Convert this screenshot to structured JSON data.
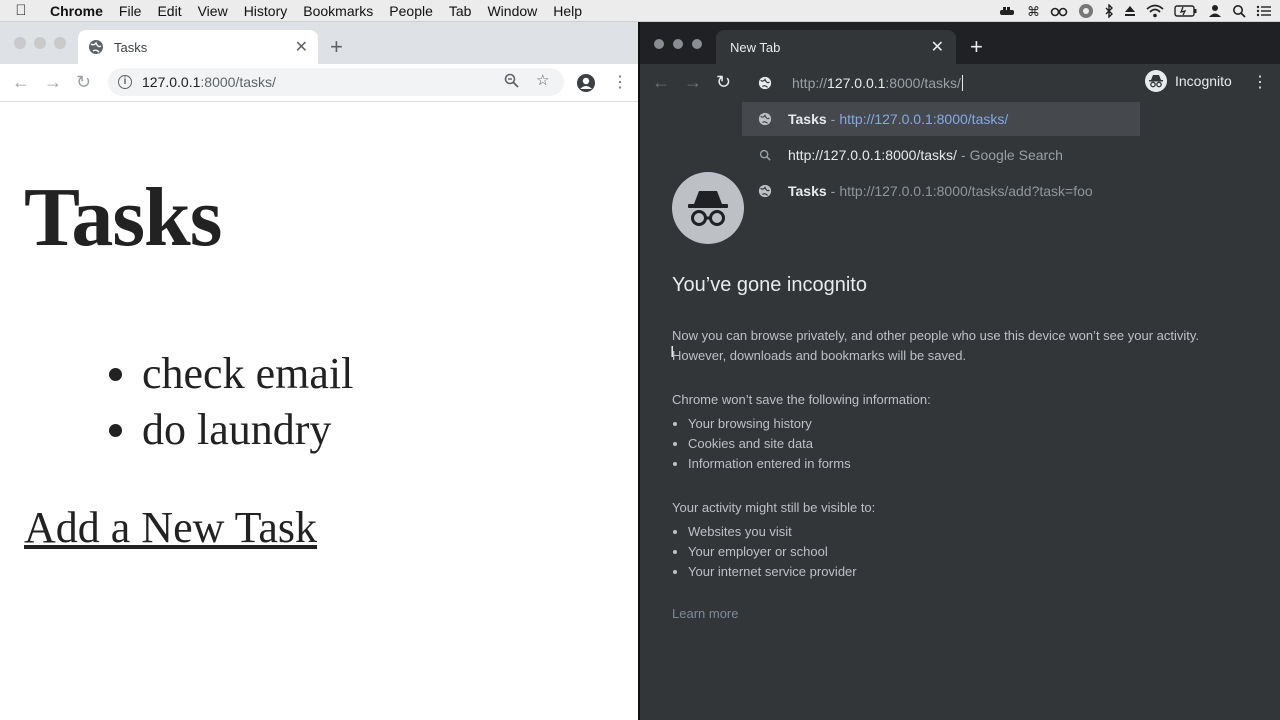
{
  "menubar": {
    "app": "Chrome",
    "items": [
      "File",
      "Edit",
      "View",
      "History",
      "Bookmarks",
      "People",
      "Tab",
      "Window",
      "Help"
    ]
  },
  "left_window": {
    "tab_title": "Tasks",
    "url_host": "127.0.0.1",
    "url_rest": ":8000/tasks/",
    "page": {
      "heading": "Tasks",
      "tasks": [
        "check email",
        "do laundry"
      ],
      "add_link": "Add a New Task"
    }
  },
  "right_window": {
    "tab_title": "New Tab",
    "omnibox": {
      "prefix": "http://",
      "host": "127.0.0.1",
      "rest": ":8000/tasks/"
    },
    "incognito_label": "Incognito",
    "suggestions": [
      {
        "icon": "globe-icon",
        "title": "Tasks",
        "sep": "-",
        "url": "http://127.0.0.1:8000/tasks/"
      },
      {
        "icon": "search-icon",
        "title": "http://127.0.0.1:8000/tasks/",
        "sep": "-",
        "url": "Google Search"
      },
      {
        "icon": "globe-icon",
        "title": "Tasks",
        "sep": "-",
        "url": "http://127.0.0.1:8000/tasks/add?task=foo"
      }
    ],
    "ntp": {
      "heading": "You’ve gone incognito",
      "intro_line1": "Now you can browse privately, and other people who use this device won’t see your activity.",
      "intro_line2": "However, downloads and bookmarks will be saved.",
      "wont_save_heading": "Chrome won’t save the following information:",
      "wont_save": [
        "Your browsing history",
        "Cookies and site data",
        "Information entered in forms"
      ],
      "visible_heading": "Your activity might still be visible to:",
      "visible": [
        "Websites you visit",
        "Your employer or school",
        "Your internet service provider"
      ],
      "learn_more": "Learn more"
    }
  },
  "colors": {
    "incognito_bg": "#323639",
    "incognito_tabstrip": "#202124",
    "suggestion_url": "#8ab4f8"
  }
}
